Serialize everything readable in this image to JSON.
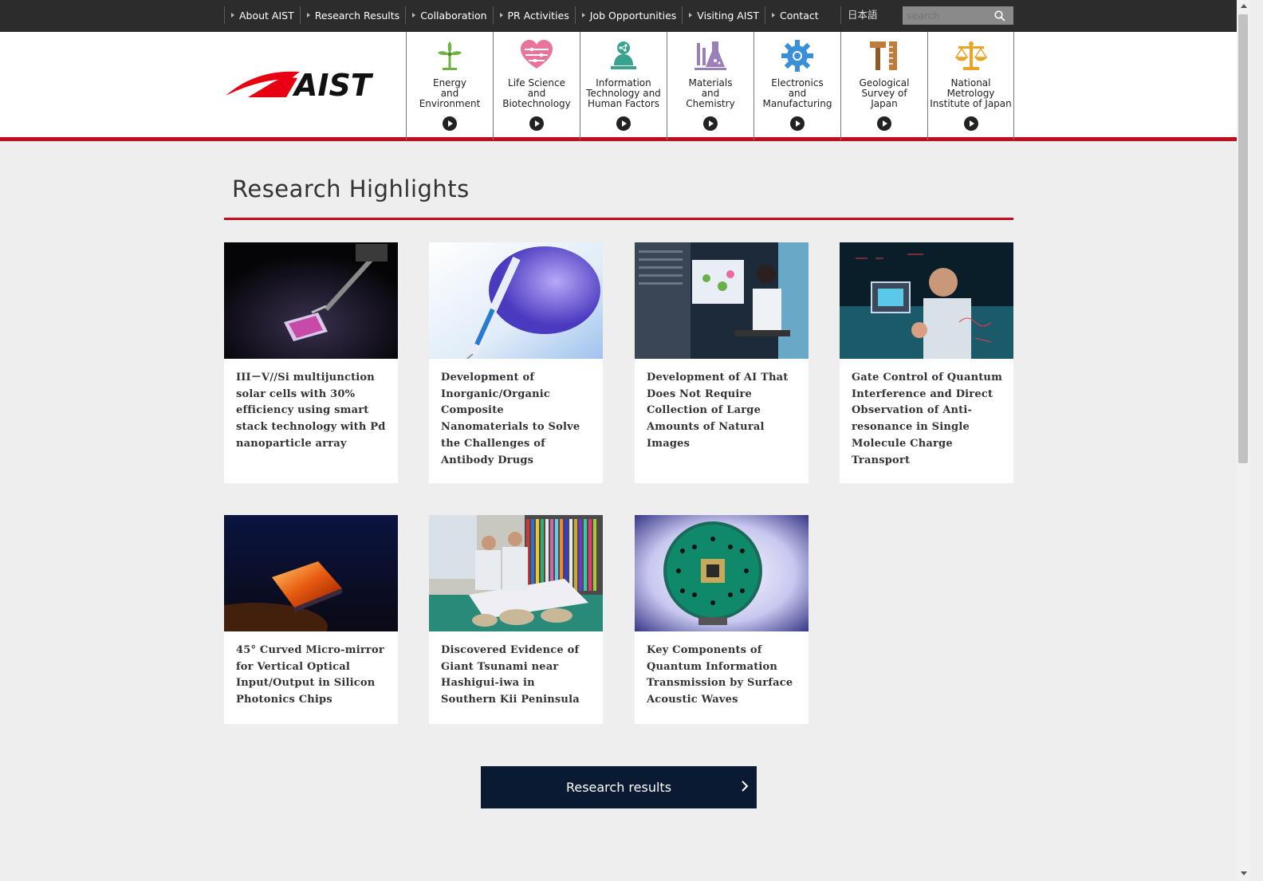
{
  "topnav": {
    "items": [
      {
        "label": "About AIST"
      },
      {
        "label": "Research Results"
      },
      {
        "label": "Collaboration"
      },
      {
        "label": "PR Activities"
      },
      {
        "label": "Job Opportunities"
      },
      {
        "label": "Visiting AIST"
      },
      {
        "label": "Contact"
      }
    ],
    "language": "日本語",
    "search_placeholder": "search"
  },
  "header": {
    "logo_text": "AIST",
    "categories": [
      {
        "label": "Energy\nand\nEnvironment",
        "icon": "windmill-icon",
        "color": "#6db33f"
      },
      {
        "label": "Life Science\nand\nBiotechnology",
        "icon": "heart-icon",
        "color": "#e8749b"
      },
      {
        "label": "Information\nTechnology and\nHuman Factors",
        "icon": "person-network-icon",
        "color": "#3aa38f"
      },
      {
        "label": "Materials\nand\nChemistry",
        "icon": "flask-icon",
        "color": "#9b7fb8"
      },
      {
        "label": "Electronics\nand\nManufacturing",
        "icon": "gear-icon",
        "color": "#3a8fd6"
      },
      {
        "label": "Geological\nSurvey of\nJapan",
        "icon": "hammer-ruler-icon",
        "color": "#c07a3a"
      },
      {
        "label": "National\nMetrology\nInstitute of Japan",
        "icon": "scale-icon",
        "color": "#e8a425"
      }
    ]
  },
  "section": {
    "title": "Research Highlights"
  },
  "highlights": [
    {
      "title": "III－V//Si multijunction solar cells with 30% efficiency using smart stack technology with Pd nanoparticle array",
      "image": "solar-cell-photo"
    },
    {
      "title": "Development of Inorganic/Organic Composite Nanomaterials to Solve the Challenges of Antibody Drugs",
      "image": "syringe-photo"
    },
    {
      "title": "Development of AI That Does Not Require Collection of Large Amounts of Natural Images",
      "image": "researcher-computer-photo"
    },
    {
      "title": "Gate Control of Quantum Interference and Direct Observation of Anti-resonance in Single Molecule Charge Transport",
      "image": "researcher-chip-photo"
    },
    {
      "title": "45° Curved Micro-mirror for Vertical Optical Input/Output in Silicon Photonics Chips",
      "image": "micro-mirror-photo"
    },
    {
      "title": "Discovered Evidence of Giant Tsunami near Hashigui-iwa in Southern Kii Peninsula",
      "image": "tsunami-research-photo"
    },
    {
      "title": "Key Components of Quantum Information Transmission by Surface Acoustic Waves",
      "image": "quantum-board-photo"
    }
  ],
  "more_button": {
    "label": "Research results"
  },
  "colors": {
    "accent": "#c20d1c",
    "topbar": "#2c2c2c",
    "button": "#0b1a33"
  }
}
